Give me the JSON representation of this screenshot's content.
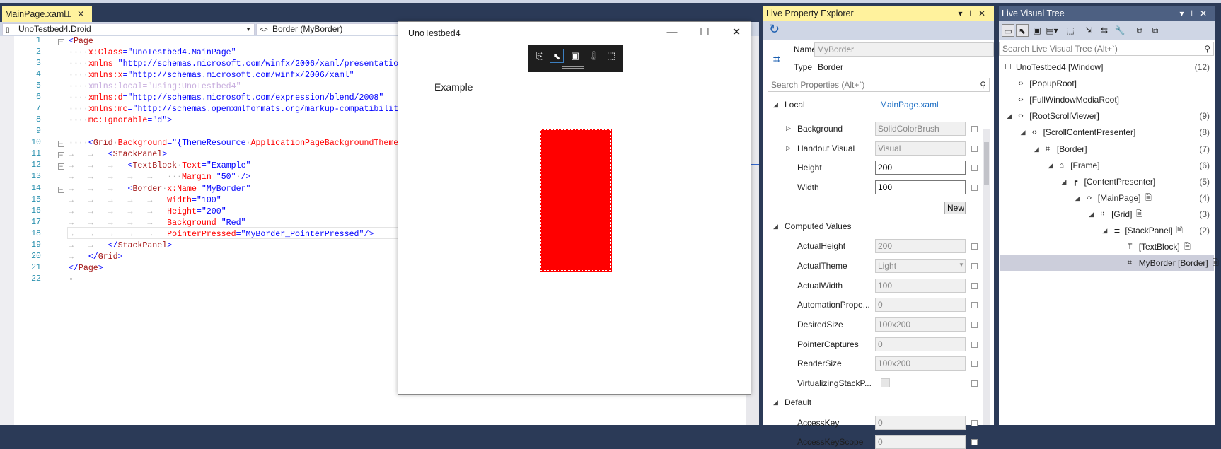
{
  "editor": {
    "tab_label": "MainPage.xaml",
    "project_combo": "UnoTestbed4.Droid",
    "member_combo": "Border (MyBorder)",
    "lines": [
      [
        [
          "<",
          "d"
        ],
        [
          "Page",
          "tag"
        ]
      ],
      [
        [
          "····",
          "ws"
        ],
        [
          "x:Class",
          "attr"
        ],
        [
          "=",
          "d"
        ],
        [
          "\"UnoTestbed4.MainPage\"",
          "val"
        ]
      ],
      [
        [
          "····",
          "ws"
        ],
        [
          "xmlns",
          "attr"
        ],
        [
          "=",
          "d"
        ],
        [
          "\"http://schemas.microsoft.com/winfx/2006/xaml/presentatio",
          "val"
        ]
      ],
      [
        [
          "····",
          "ws"
        ],
        [
          "xmlns:x",
          "attr"
        ],
        [
          "=",
          "d"
        ],
        [
          "\"http://schemas.microsoft.com/winfx/2006/xaml\"",
          "val"
        ]
      ],
      [
        [
          "····",
          "ws"
        ],
        [
          "xmlns:local=\"using:UnoTestbed4\"",
          "fade"
        ]
      ],
      [
        [
          "····",
          "ws"
        ],
        [
          "xmlns:d",
          "attr"
        ],
        [
          "=",
          "d"
        ],
        [
          "\"http://schemas.microsoft.com/expression/blend/2008\"",
          "val"
        ]
      ],
      [
        [
          "····",
          "ws"
        ],
        [
          "xmlns:mc",
          "attr"
        ],
        [
          "=",
          "d"
        ],
        [
          "\"http://schemas.openxmlformats.org/markup-compatibilit",
          "val"
        ]
      ],
      [
        [
          "····",
          "ws"
        ],
        [
          "mc:Ignorable",
          "attr"
        ],
        [
          "=",
          "d"
        ],
        [
          "\"d\">",
          "val"
        ]
      ],
      [],
      [
        [
          "····",
          "ws"
        ],
        [
          "<",
          "d"
        ],
        [
          "Grid",
          "tag"
        ],
        [
          "·",
          "ws"
        ],
        [
          "Background",
          "attr"
        ],
        [
          "=",
          "d"
        ],
        [
          "\"{ThemeResource",
          "val"
        ],
        [
          "·",
          "ws"
        ],
        [
          "ApplicationPageBackgroundTheme",
          "attr"
        ]
      ],
      [
        [
          "→   →   ",
          "ws"
        ],
        [
          "<",
          "d"
        ],
        [
          "StackPanel",
          "tag"
        ],
        [
          ">",
          "d"
        ]
      ],
      [
        [
          "→   →   →   ",
          "ws"
        ],
        [
          "<",
          "d"
        ],
        [
          "TextBlock",
          "tag"
        ],
        [
          "·",
          "ws"
        ],
        [
          "Text",
          "attr"
        ],
        [
          "=",
          "d"
        ],
        [
          "\"Example\"",
          "val"
        ]
      ],
      [
        [
          "→   →   →   →   →   ···",
          "ws"
        ],
        [
          "Margin",
          "attr"
        ],
        [
          "=",
          "d"
        ],
        [
          "\"50\"",
          "val"
        ],
        [
          "·",
          "ws"
        ],
        [
          "/>",
          "d"
        ]
      ],
      [
        [
          "→   →   →   ",
          "ws"
        ],
        [
          "<",
          "d"
        ],
        [
          "Border",
          "tag"
        ],
        [
          "·",
          "ws"
        ],
        [
          "x:Name",
          "attr"
        ],
        [
          "=",
          "d"
        ],
        [
          "\"MyBorder\"",
          "val"
        ]
      ],
      [
        [
          "→   →   →   →   →   ",
          "ws"
        ],
        [
          "Width",
          "attr"
        ],
        [
          "=",
          "d"
        ],
        [
          "\"100\"",
          "val"
        ]
      ],
      [
        [
          "→   →   →   →   →   ",
          "ws"
        ],
        [
          "Height",
          "attr"
        ],
        [
          "=",
          "d"
        ],
        [
          "\"200\"",
          "val"
        ]
      ],
      [
        [
          "→   →   →   →   →   ",
          "ws"
        ],
        [
          "Background",
          "attr"
        ],
        [
          "=",
          "d"
        ],
        [
          "\"Red\"",
          "val"
        ]
      ],
      [
        [
          "→   →   →   →   →   ",
          "ws"
        ],
        [
          "PointerPressed",
          "attr"
        ],
        [
          "=",
          "d"
        ],
        [
          "\"MyBorder_PointerPressed\"/>",
          "val"
        ]
      ],
      [
        [
          "→   →   ",
          "ws"
        ],
        [
          "</",
          "d"
        ],
        [
          "StackPanel",
          "tag"
        ],
        [
          ">",
          "d"
        ]
      ],
      [
        [
          "→   ",
          "ws"
        ],
        [
          "</",
          "d"
        ],
        [
          "Grid",
          "tag"
        ],
        [
          ">",
          "d"
        ]
      ],
      [
        [
          "</",
          "d"
        ],
        [
          "Page",
          "tag"
        ],
        [
          ">",
          "d"
        ]
      ],
      [
        [
          "▫",
          "ws"
        ]
      ]
    ],
    "fold_lines": [
      1,
      10,
      11,
      12,
      14
    ]
  },
  "app": {
    "title": "UnoTestbed4",
    "example_text": "Example",
    "border_color": "#FF0000"
  },
  "lpe": {
    "title": "Live Property Explorer",
    "name_label": "Name",
    "name_value": "MyBorder",
    "type_label": "Type",
    "type_value": "Border",
    "search_placeholder": "Search Properties (Alt+`)",
    "local_label": "Local",
    "local_source": "MainPage.xaml",
    "new_label": "New",
    "rows": [
      {
        "kind": "prop",
        "label": "Background",
        "value": "SolidColorBrush",
        "expander": true,
        "editable": false
      },
      {
        "kind": "prop",
        "label": "Handout Visual",
        "value": "Visual",
        "expander": true,
        "editable": false
      },
      {
        "kind": "prop",
        "label": "Height",
        "value": "200",
        "editable": true
      },
      {
        "kind": "prop",
        "label": "Width",
        "value": "100",
        "editable": true
      },
      {
        "kind": "new"
      },
      {
        "kind": "section",
        "label": "Computed Values"
      },
      {
        "kind": "prop",
        "label": "ActualHeight",
        "value": "200"
      },
      {
        "kind": "prop",
        "label": "ActualTheme",
        "value": "Light",
        "dropdown": true
      },
      {
        "kind": "prop",
        "label": "ActualWidth",
        "value": "100"
      },
      {
        "kind": "prop",
        "label": "AutomationPrope...",
        "value": "0"
      },
      {
        "kind": "prop",
        "label": "DesiredSize",
        "value": "100x200"
      },
      {
        "kind": "prop",
        "label": "PointerCaptures",
        "value": "0"
      },
      {
        "kind": "prop",
        "label": "RenderSize",
        "value": "100x200"
      },
      {
        "kind": "prop",
        "label": "VirtualizingStackP...",
        "checkbox": true
      },
      {
        "kind": "section",
        "label": "Default"
      },
      {
        "kind": "prop",
        "label": "AccessKey",
        "value": "0"
      },
      {
        "kind": "prop",
        "label": "AccessKeyScope",
        "value": "0"
      }
    ]
  },
  "lvt": {
    "title": "Live Visual Tree",
    "search_placeholder": "Search Live Visual Tree (Alt+`)",
    "items": [
      {
        "level": 0,
        "icon": "☐",
        "label": "UnoTestbed4 [Window]",
        "count": "(12)"
      },
      {
        "level": 1,
        "icon": "‹›",
        "label": "[PopupRoot]"
      },
      {
        "level": 1,
        "icon": "‹›",
        "label": "[FullWindowMediaRoot]"
      },
      {
        "level": 1,
        "icon": "‹›",
        "label": "[RootScrollViewer]",
        "count": "(9)",
        "expanded": true
      },
      {
        "level": 2,
        "icon": "‹›",
        "label": "[ScrollContentPresenter]",
        "count": "(8)",
        "expanded": true
      },
      {
        "level": 3,
        "icon": "⌗",
        "label": "[Border]",
        "count": "(7)",
        "expanded": true
      },
      {
        "level": 4,
        "icon": "⌂",
        "label": "[Frame]",
        "count": "(6)",
        "expanded": true
      },
      {
        "level": 5,
        "icon": "┏",
        "label": "[ContentPresenter]",
        "count": "(5)",
        "expanded": true
      },
      {
        "level": 6,
        "icon": "‹›",
        "label": "[MainPage]",
        "count": "(4)",
        "expanded": true,
        "doc": true
      },
      {
        "level": 7,
        "icon": "⁞⁞",
        "label": "[Grid]",
        "count": "(3)",
        "expanded": true,
        "doc": true
      },
      {
        "level": 8,
        "icon": "≣",
        "label": "[StackPanel]",
        "count": "(2)",
        "expanded": true,
        "doc": true
      },
      {
        "level": 9,
        "icon": "T",
        "label": "[TextBlock]",
        "doc": true
      },
      {
        "level": 9,
        "icon": "⌗",
        "label": "MyBorder [Border]",
        "doc": true,
        "selected": true
      }
    ]
  }
}
